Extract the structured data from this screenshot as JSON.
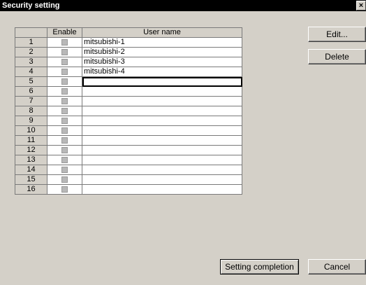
{
  "window": {
    "title": "Security setting",
    "close_label": "×"
  },
  "table": {
    "headers": [
      "",
      "Enable",
      "User name"
    ],
    "rows": [
      {
        "num": "1",
        "enabled": false,
        "name": "mitsubishi-1"
      },
      {
        "num": "2",
        "enabled": false,
        "name": "mitsubishi-2"
      },
      {
        "num": "3",
        "enabled": false,
        "name": "mitsubishi-3"
      },
      {
        "num": "4",
        "enabled": false,
        "name": "mitsubishi-4"
      },
      {
        "num": "5",
        "enabled": false,
        "name": ""
      },
      {
        "num": "6",
        "enabled": false,
        "name": ""
      },
      {
        "num": "7",
        "enabled": false,
        "name": ""
      },
      {
        "num": "8",
        "enabled": false,
        "name": ""
      },
      {
        "num": "9",
        "enabled": false,
        "name": ""
      },
      {
        "num": "10",
        "enabled": false,
        "name": ""
      },
      {
        "num": "11",
        "enabled": false,
        "name": ""
      },
      {
        "num": "12",
        "enabled": false,
        "name": ""
      },
      {
        "num": "13",
        "enabled": false,
        "name": ""
      },
      {
        "num": "14",
        "enabled": false,
        "name": ""
      },
      {
        "num": "15",
        "enabled": false,
        "name": ""
      },
      {
        "num": "16",
        "enabled": false,
        "name": ""
      }
    ],
    "selected_row": 5
  },
  "buttons": {
    "edit": "Edit...",
    "delete": "Delete",
    "setting_completion": "Setting completion",
    "cancel": "Cancel"
  }
}
